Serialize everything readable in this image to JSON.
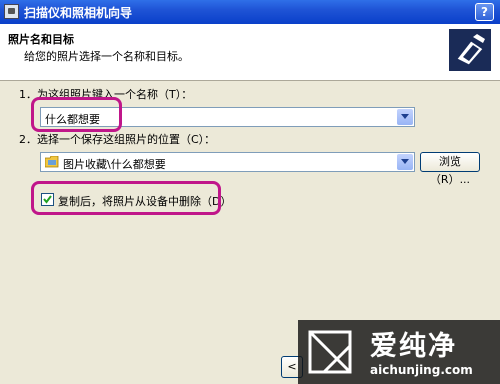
{
  "window": {
    "title": "扫描仪和照相机向导",
    "help_label": "?"
  },
  "header": {
    "title": "照片名和目标",
    "subtitle": "给您的照片选择一个名称和目标。",
    "icon": "scanner-camera-icon"
  },
  "step1": {
    "label": "1．为这组照片键入一个名称（T）：",
    "value": "什么都想要"
  },
  "step2": {
    "label": "2．选择一个保存这组照片的位置（C）：",
    "value": "图片收藏\\什么都想要",
    "browse_label": "浏览（R）..."
  },
  "option": {
    "delete_after_copy_label": "复制后，将照片从设备中删除（D）",
    "checked": true
  },
  "footer": {
    "back_label": "<"
  },
  "watermark": {
    "title": "爱纯净",
    "url": "aichunjing.com",
    "accent": "#ffffff"
  },
  "colors": {
    "highlight": "#c0168a",
    "titlebar": "#1f54d6",
    "dialog": "#ece9d8"
  }
}
